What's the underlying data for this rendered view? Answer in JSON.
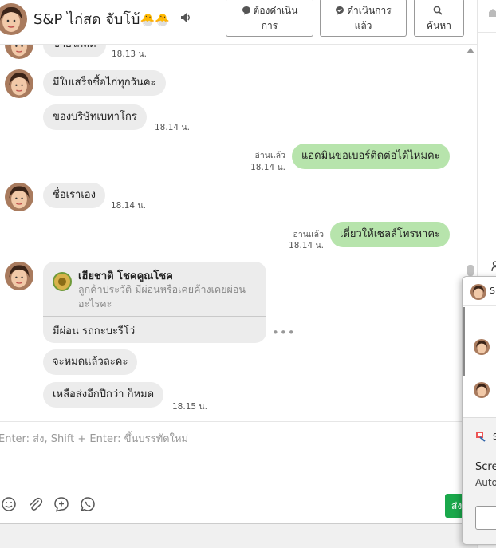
{
  "header": {
    "title": "S&P ไก่สด จับโบ้",
    "title_emoji": "🐣🐣",
    "buttons": {
      "todo_line1": "ต้องดำเนิน",
      "todo_line2": "การ",
      "done_line1": "ดำเนินการ",
      "done_line2": "แล้ว",
      "search": "ค้นหา"
    }
  },
  "messages": [
    {
      "direction": "in",
      "text": "ขายไก่สด",
      "time": "18.13 น."
    },
    {
      "direction": "in",
      "text": "มีใบเสร็จซื้อไก่ทุกวันคะ",
      "time": ""
    },
    {
      "direction": "in",
      "text": "ของบริษัทเบทาโกร",
      "time": "18.14 น."
    },
    {
      "direction": "out",
      "text": "แอดมินขอเบอร์ติดต่อได้ไหมคะ",
      "read": "อ่านแล้ว",
      "time": "18.14 น."
    },
    {
      "direction": "in",
      "text": "ชื่อเราเอง",
      "time": "18.14 น."
    },
    {
      "direction": "out",
      "text": "เดี๋ยวให้เซลล์โทรหาคะ",
      "read": "อ่านแล้ว",
      "time": "18.14 น."
    },
    {
      "direction": "in",
      "text": "จะหมดแล้วละคะ",
      "time": ""
    },
    {
      "direction": "in",
      "text": "เหลือส่งอีกปีกว่า ก็หมด",
      "time": "18.15 น."
    }
  ],
  "card": {
    "name": "เฮียชาติ โชคคูณโชค",
    "subtitle": "ลูกค้าประวัติ มีผ่อนหรือเคยค้างเคยผ่อนอะไรคะ",
    "message": "มีผ่อน รถกะบะรีโว่"
  },
  "composer": {
    "placeholder": "Enter: ส่ง, Shift + Enter: ขึ้นบรรทัดใหม่",
    "send_label": "ส่ง"
  },
  "popup": {
    "head_text": "S",
    "bug_text": "S",
    "text1": "Scre",
    "text2": "Auto"
  },
  "colors": {
    "incoming_bubble": "#ececec",
    "outgoing_bubble": "#b7e4ac",
    "send_button": "#1aa84b"
  }
}
